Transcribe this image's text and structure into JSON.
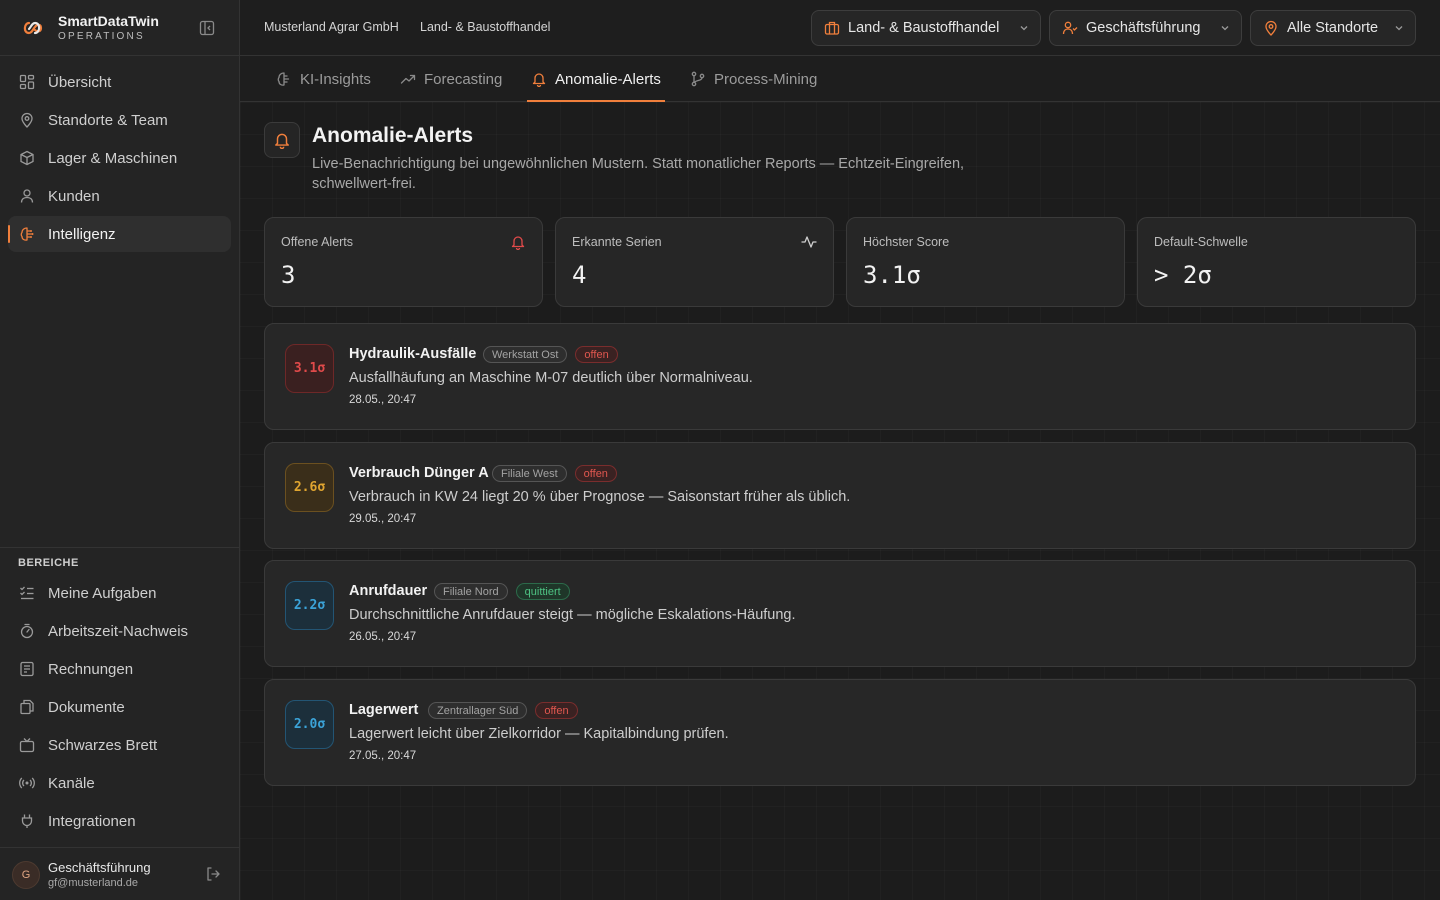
{
  "app": {
    "name": "SmartDataTwin",
    "subtitle": "OPERATIONS"
  },
  "sidebar": {
    "main_items": [
      {
        "label": "Übersicht",
        "icon": "grid-icon"
      },
      {
        "label": "Standorte & Team",
        "icon": "map-pin-icon"
      },
      {
        "label": "Lager & Maschinen",
        "icon": "box-icon"
      },
      {
        "label": "Kunden",
        "icon": "user-icon"
      },
      {
        "label": "Intelligenz",
        "icon": "brain-icon",
        "active": true
      }
    ],
    "section_title": "BEREICHE",
    "section_items": [
      {
        "label": "Meine Aufgaben",
        "icon": "checklist-icon"
      },
      {
        "label": "Arbeitszeit-Nachweis",
        "icon": "stopwatch-icon"
      },
      {
        "label": "Rechnungen",
        "icon": "receipt-icon"
      },
      {
        "label": "Dokumente",
        "icon": "files-icon"
      },
      {
        "label": "Schwarzes Brett",
        "icon": "tv-icon"
      },
      {
        "label": "Kanäle",
        "icon": "broadcast-icon"
      },
      {
        "label": "Integrationen",
        "icon": "plug-icon"
      }
    ],
    "user": {
      "initial": "G",
      "name": "Geschäftsführung",
      "email": "gf@musterland.de"
    }
  },
  "header": {
    "company": "Musterland Agrar GmbH",
    "division": "Land- & Baustoffhandel",
    "selects": {
      "branch": "Land- & Baustoffhandel",
      "role": "Geschäftsführung",
      "location": "Alle Standorte"
    }
  },
  "tabs": [
    {
      "label": "KI-Insights",
      "icon": "brain-icon"
    },
    {
      "label": "Forecasting",
      "icon": "trending-up-icon"
    },
    {
      "label": "Anomalie-Alerts",
      "icon": "bell-icon",
      "active": true
    },
    {
      "label": "Process-Mining",
      "icon": "git-branch-icon"
    }
  ],
  "page": {
    "title": "Anomalie-Alerts",
    "description": "Live-Benachrichtigung bei ungewöhnlichen Mustern. Statt monatlicher Reports — Echtzeit-Eingreifen, schwellwert-frei."
  },
  "stats": [
    {
      "label": "Offene Alerts",
      "value": "3",
      "icon": "bell-icon"
    },
    {
      "label": "Erkannte Serien",
      "value": "4",
      "icon": "activity-icon"
    },
    {
      "label": "Höchster Score",
      "value": "3.1σ"
    },
    {
      "label": "Default-Schwelle",
      "value": "> 2σ"
    }
  ],
  "colors": {
    "accent": "#f07f3c",
    "severity_high": "#e04a4a",
    "severity_medium": "#e0a530",
    "severity_low": "#3ba3d8",
    "status_open": "#e0574f",
    "status_acknowledged": "#4ec283"
  },
  "alerts": [
    {
      "score": "3.1σ",
      "severity": "high",
      "title": "Hydraulik-Ausfälle",
      "location": "Werkstatt Ost",
      "status": "offen",
      "status_type": "open",
      "description": "Ausfallhäufung an Maschine M-07 deutlich über Normalniveau.",
      "time": "28.05., 20:47"
    },
    {
      "score": "2.6σ",
      "severity": "medium",
      "title": "Verbrauch Dünger A",
      "location": "Filiale West",
      "status": "offen",
      "status_type": "open",
      "description": "Verbrauch in KW 24 liegt 20 % über Prognose — Saisonstart früher als üblich.",
      "time": "29.05., 20:47"
    },
    {
      "score": "2.2σ",
      "severity": "low",
      "title": "Anrufdauer",
      "location": "Filiale Nord",
      "status": "quittiert",
      "status_type": "ack",
      "description": "Durchschnittliche Anrufdauer steigt — mögliche Eskalations-Häufung.",
      "time": "26.05., 20:47"
    },
    {
      "score": "2.0σ",
      "severity": "low",
      "title": "Lagerwert",
      "location": "Zentrallager Süd",
      "status": "offen",
      "status_type": "open",
      "description": "Lagerwert leicht über Zielkorridor — Kapitalbindung prüfen.",
      "time": "27.05., 20:47"
    }
  ]
}
